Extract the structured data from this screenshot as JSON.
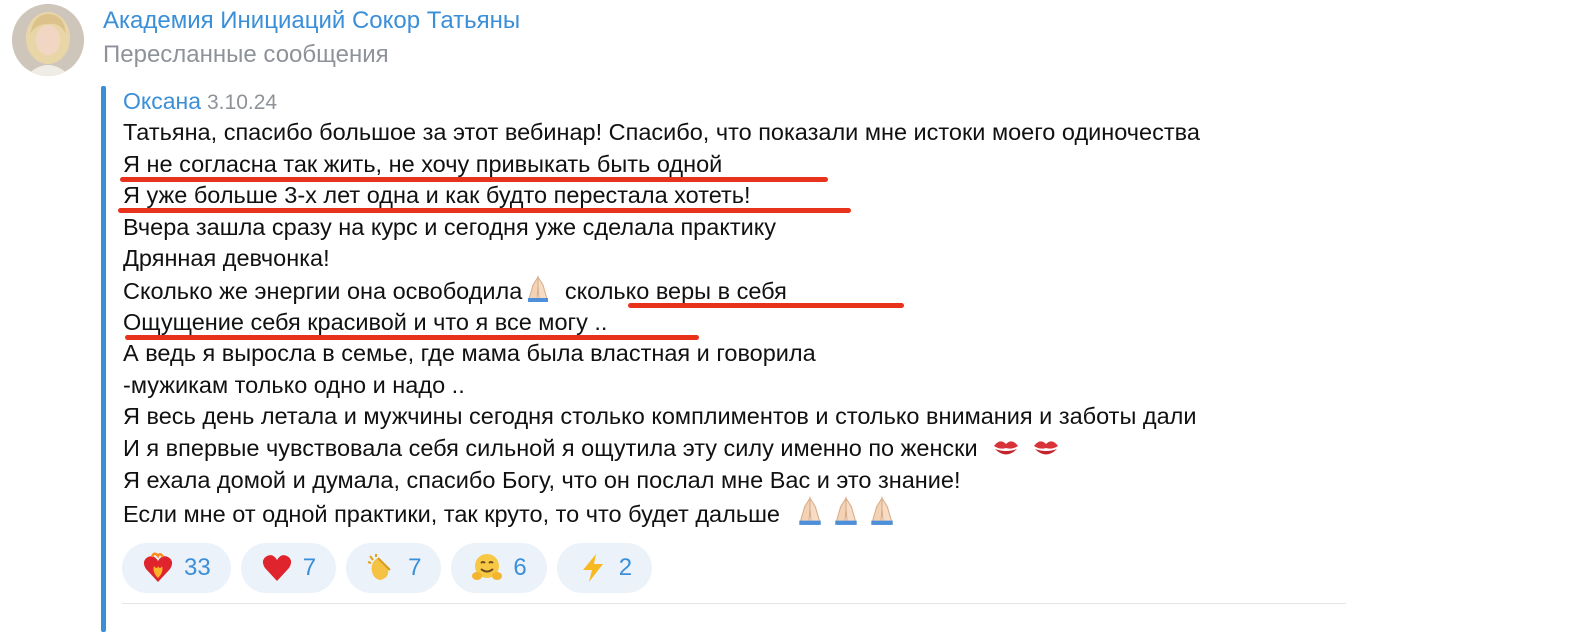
{
  "header": {
    "title": "Академия Инициаций Сокор Татьяны",
    "subtitle": "Пересланные сообщения"
  },
  "message": {
    "sender": "Оксана",
    "date": "3.10.24",
    "lines": [
      "Татьяна, спасибо большое за этот вебинар! Спасибо, что показали мне истоки моего одиночества",
      "Я не согласна так жить, не хочу привыкать быть одной",
      "Я уже больше 3-х лет одна и как будто перестала хотеть!",
      "Вчера зашла сразу на курс и сегодня уже сделала практику",
      "Дрянная девчонка!",
      "Сколько же энергии она освободила",
      "сколько веры в себя",
      "Ощущение себя красивой и что я все могу ..",
      "А ведь я выросла в семье, где мама была властная и говорила",
      "-мужикам только одно и надо ..",
      "Я весь день летала и мужчины сегодня столько комплиментов и столько внимания и заботы дали",
      "И я впервые чувствовала себя сильной я ощутила эту силу именно по женски",
      "Я ехала домой и думала, спасибо Богу, что он послал мне Вас и это знание!",
      "Если мне от одной практики, так круто, то что будет дальше"
    ],
    "highlight_color": "#e8321c"
  },
  "reactions": [
    {
      "icon": "heart-on-fire-icon",
      "count": "33"
    },
    {
      "icon": "red-heart-icon",
      "count": "7"
    },
    {
      "icon": "clapping-hands-icon",
      "count": "7"
    },
    {
      "icon": "hugging-face-icon",
      "count": "6"
    },
    {
      "icon": "lightning-icon",
      "count": "2"
    }
  ],
  "colors": {
    "accent": "#3a8fd8",
    "muted": "#8e9399",
    "reaction_bg": "#ebf2f9"
  }
}
